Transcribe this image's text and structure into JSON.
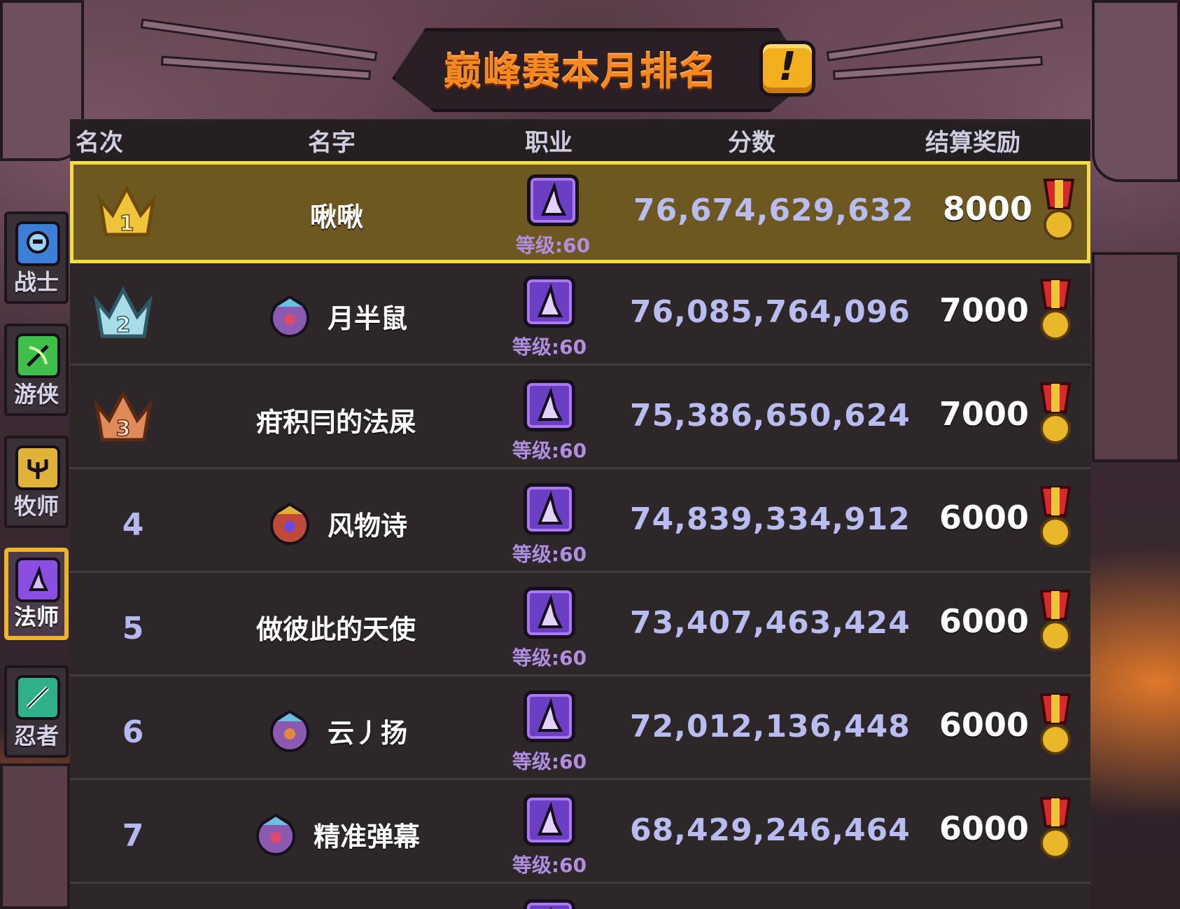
{
  "title": "巅峰赛本月排名",
  "info_button": "!",
  "sidebar": {
    "tabs": [
      {
        "label": "战士",
        "icon": "warrior-icon",
        "active": false,
        "color": "#3b7fd6"
      },
      {
        "label": "游侠",
        "icon": "ranger-icon",
        "active": false,
        "color": "#3fbf4a"
      },
      {
        "label": "牧师",
        "icon": "priest-icon",
        "active": false,
        "color": "#e0b23a"
      },
      {
        "label": "法师",
        "icon": "mage-icon",
        "active": true,
        "color": "#8a4fe0"
      },
      {
        "label": "忍者",
        "icon": "ninja-icon",
        "active": false,
        "color": "#2fb08a"
      }
    ]
  },
  "table": {
    "headers": {
      "rank": "名次",
      "name": "名字",
      "class": "职业",
      "score": "分数",
      "reward": "结算奖励"
    },
    "rows": [
      {
        "rank": "1",
        "name": "啾啾",
        "has_avatar": false,
        "level": "等级:60",
        "score": "76,674,629,632",
        "reward": "8000"
      },
      {
        "rank": "2",
        "name": "月半鼠",
        "has_avatar": true,
        "level": "等级:60",
        "score": "76,085,764,096",
        "reward": "7000"
      },
      {
        "rank": "3",
        "name": "疳积冃的法屎",
        "has_avatar": false,
        "level": "等级:60",
        "score": "75,386,650,624",
        "reward": "7000"
      },
      {
        "rank": "4",
        "name": "风物诗",
        "has_avatar": true,
        "level": "等级:60",
        "score": "74,839,334,912",
        "reward": "6000"
      },
      {
        "rank": "5",
        "name": "做彼此的天使",
        "has_avatar": false,
        "level": "等级:60",
        "score": "73,407,463,424",
        "reward": "6000"
      },
      {
        "rank": "6",
        "name": "云丿扬",
        "has_avatar": true,
        "level": "等级:60",
        "score": "72,012,136,448",
        "reward": "6000"
      },
      {
        "rank": "7",
        "name": "精准弹幕",
        "has_avatar": true,
        "level": "等级:60",
        "score": "68,429,246,464",
        "reward": "6000"
      }
    ]
  },
  "colors": {
    "title": "#f5891f",
    "highlight_bg": "#6d5822",
    "highlight_border": "#f3dd43",
    "score": "#b9bcf0",
    "level": "#b08fe0",
    "crown_gold": "#f0c43a",
    "crown_silver": "#a8dce8",
    "crown_bronze": "#e08a5a"
  }
}
